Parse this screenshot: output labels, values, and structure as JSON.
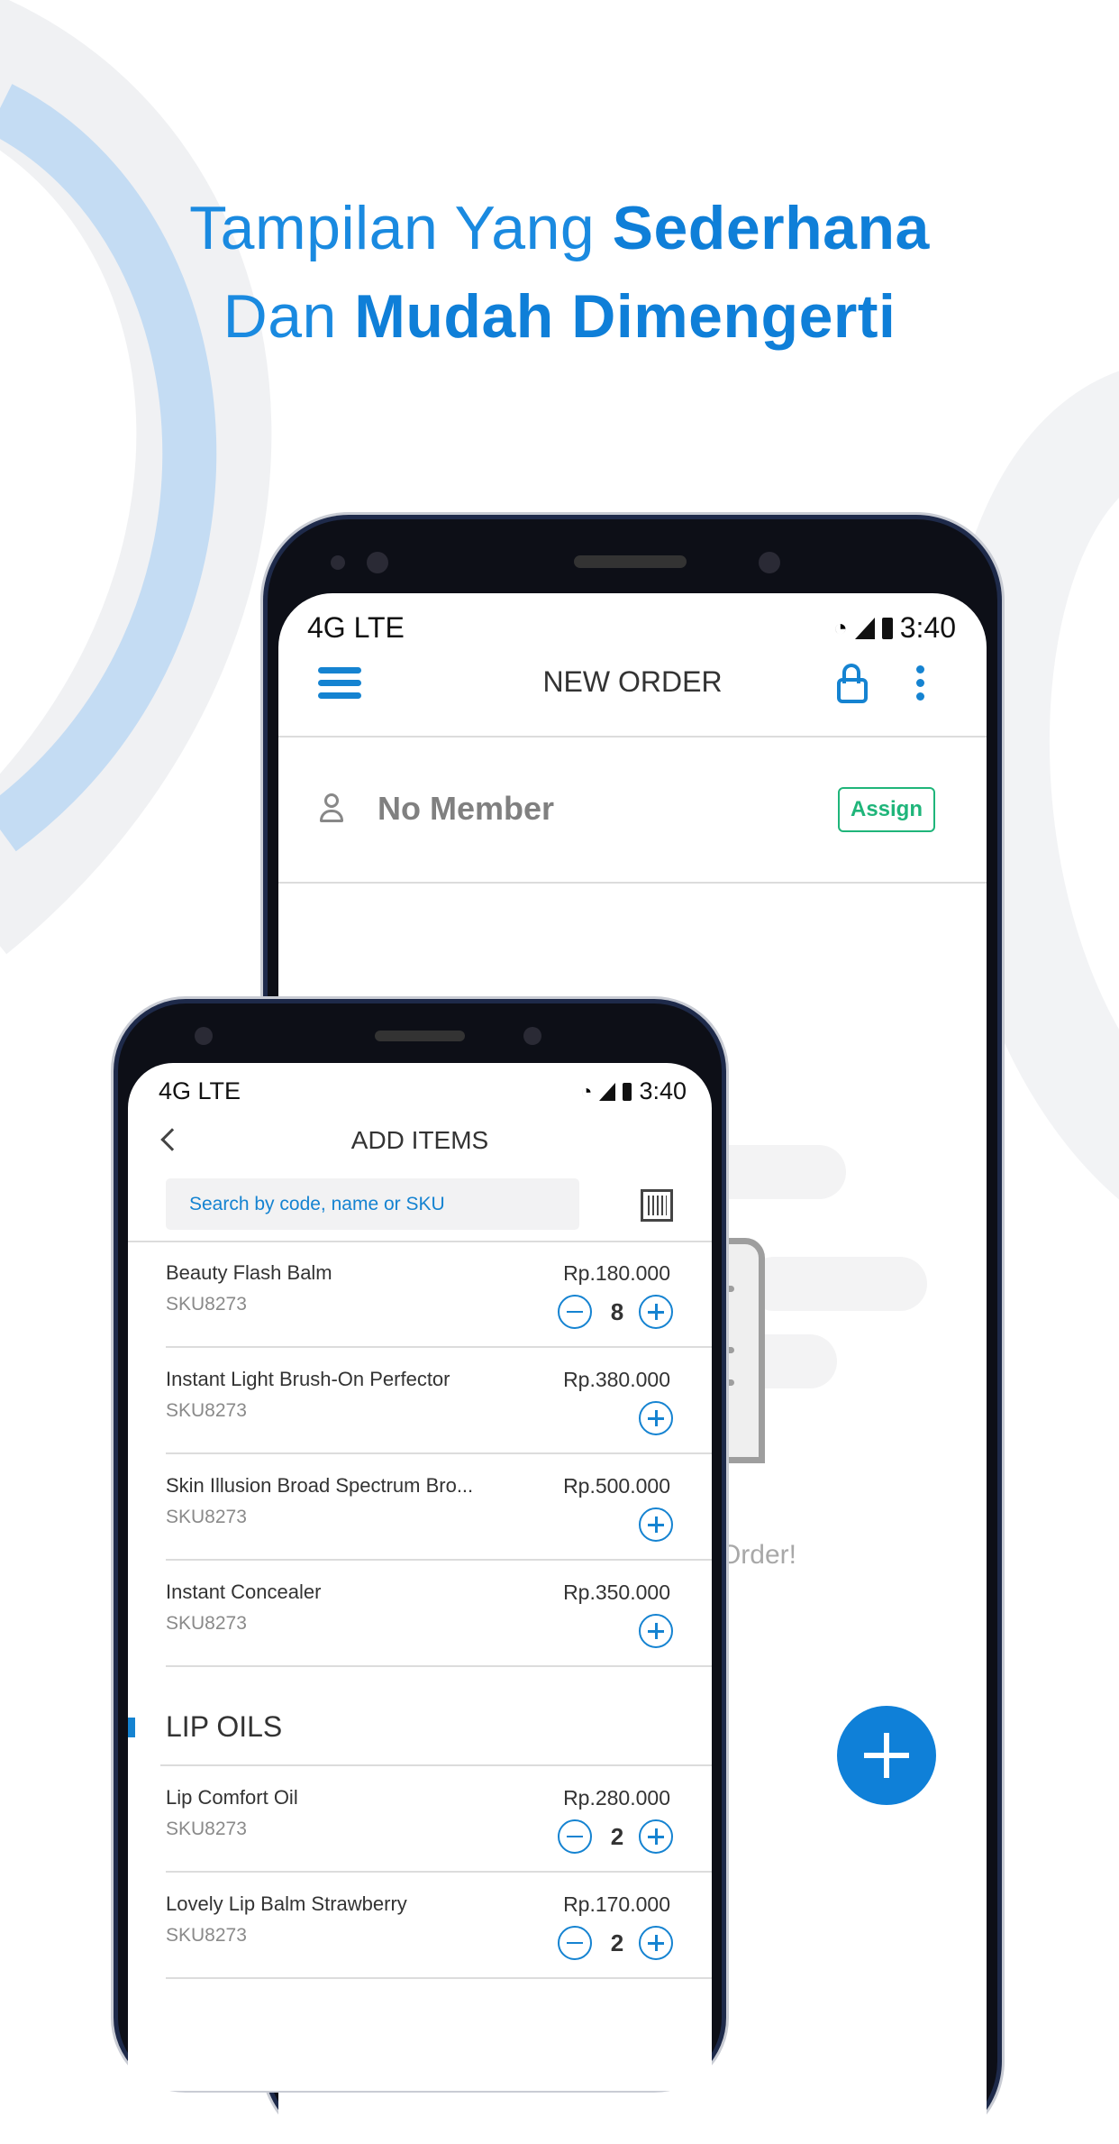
{
  "headline": {
    "line1_regular": "Tampilan Yang ",
    "line1_bold": "Sederhana",
    "line2_regular": "Dan ",
    "line2_bold": "Mudah Dimengerti"
  },
  "colors": {
    "accent": "#1583d1",
    "assign": "#1fb57a",
    "fab": "#0f80d8"
  },
  "back_phone": {
    "status": {
      "network": "4G LTE",
      "time": "3:40"
    },
    "toolbar": {
      "title": "NEW ORDER",
      "menu_icon": "hamburger-icon",
      "lock_icon": "unlock-icon",
      "more_icon": "more-vertical-icon"
    },
    "member": {
      "label": "No Member",
      "assign_label": "Assign"
    },
    "empty_state": {
      "text_visible": "is Order!"
    },
    "fab_icon": "plus-icon"
  },
  "front_phone": {
    "status": {
      "network": "4G LTE",
      "time": "3:40"
    },
    "toolbar": {
      "title": "ADD ITEMS",
      "back_icon": "chevron-left-icon"
    },
    "search": {
      "placeholder": "Search by code, name or SKU",
      "barcode_icon": "barcode-scan-icon"
    },
    "items": [
      {
        "name": "Beauty Flash Balm",
        "sku": "SKU8273",
        "price": "Rp.180.000",
        "qty": "8"
      },
      {
        "name": "Instant Light Brush-On Perfector",
        "sku": "SKU8273",
        "price": "Rp.380.000",
        "qty": null
      },
      {
        "name": "Skin Illusion Broad Spectrum Bro...",
        "sku": "SKU8273",
        "price": "Rp.500.000",
        "qty": null
      },
      {
        "name": "Instant Concealer",
        "sku": "SKU8273",
        "price": "Rp.350.000",
        "qty": null
      }
    ],
    "section": {
      "title": "LIP OILS"
    },
    "section_items": [
      {
        "name": "Lip Comfort Oil",
        "sku": "SKU8273",
        "price": "Rp.280.000",
        "qty": "2"
      },
      {
        "name": "Lovely Lip Balm Strawberry",
        "sku": "SKU8273",
        "price": "Rp.170.000",
        "qty": "2"
      }
    ]
  }
}
